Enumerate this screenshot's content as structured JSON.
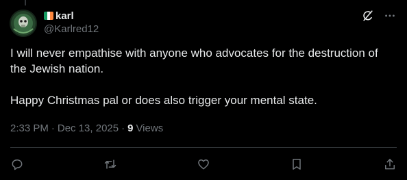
{
  "author": {
    "display_name": "karl",
    "handle": "@Karlred12",
    "flag_colors": [
      "#169b62",
      "#ffffff",
      "#ff883e"
    ]
  },
  "tweet": {
    "paragraphs": [
      "I will never empathise with anyone who advocates for the destruction of the Jewish nation.",
      "Happy Christmas pal or does also trigger your mental state."
    ]
  },
  "meta": {
    "time": "2:33 PM",
    "date": "Dec 13, 2025",
    "separator": "·",
    "views_count": "9",
    "views_label": "Views"
  },
  "top_icons": [
    "grok-icon",
    "more-icon"
  ],
  "actions": [
    "reply-icon",
    "retweet-icon",
    "like-icon",
    "bookmark-icon",
    "share-icon"
  ],
  "colors": {
    "background": "#000000",
    "text": "#e7e9ea",
    "secondary": "#71767b",
    "divider": "#2f3336"
  }
}
